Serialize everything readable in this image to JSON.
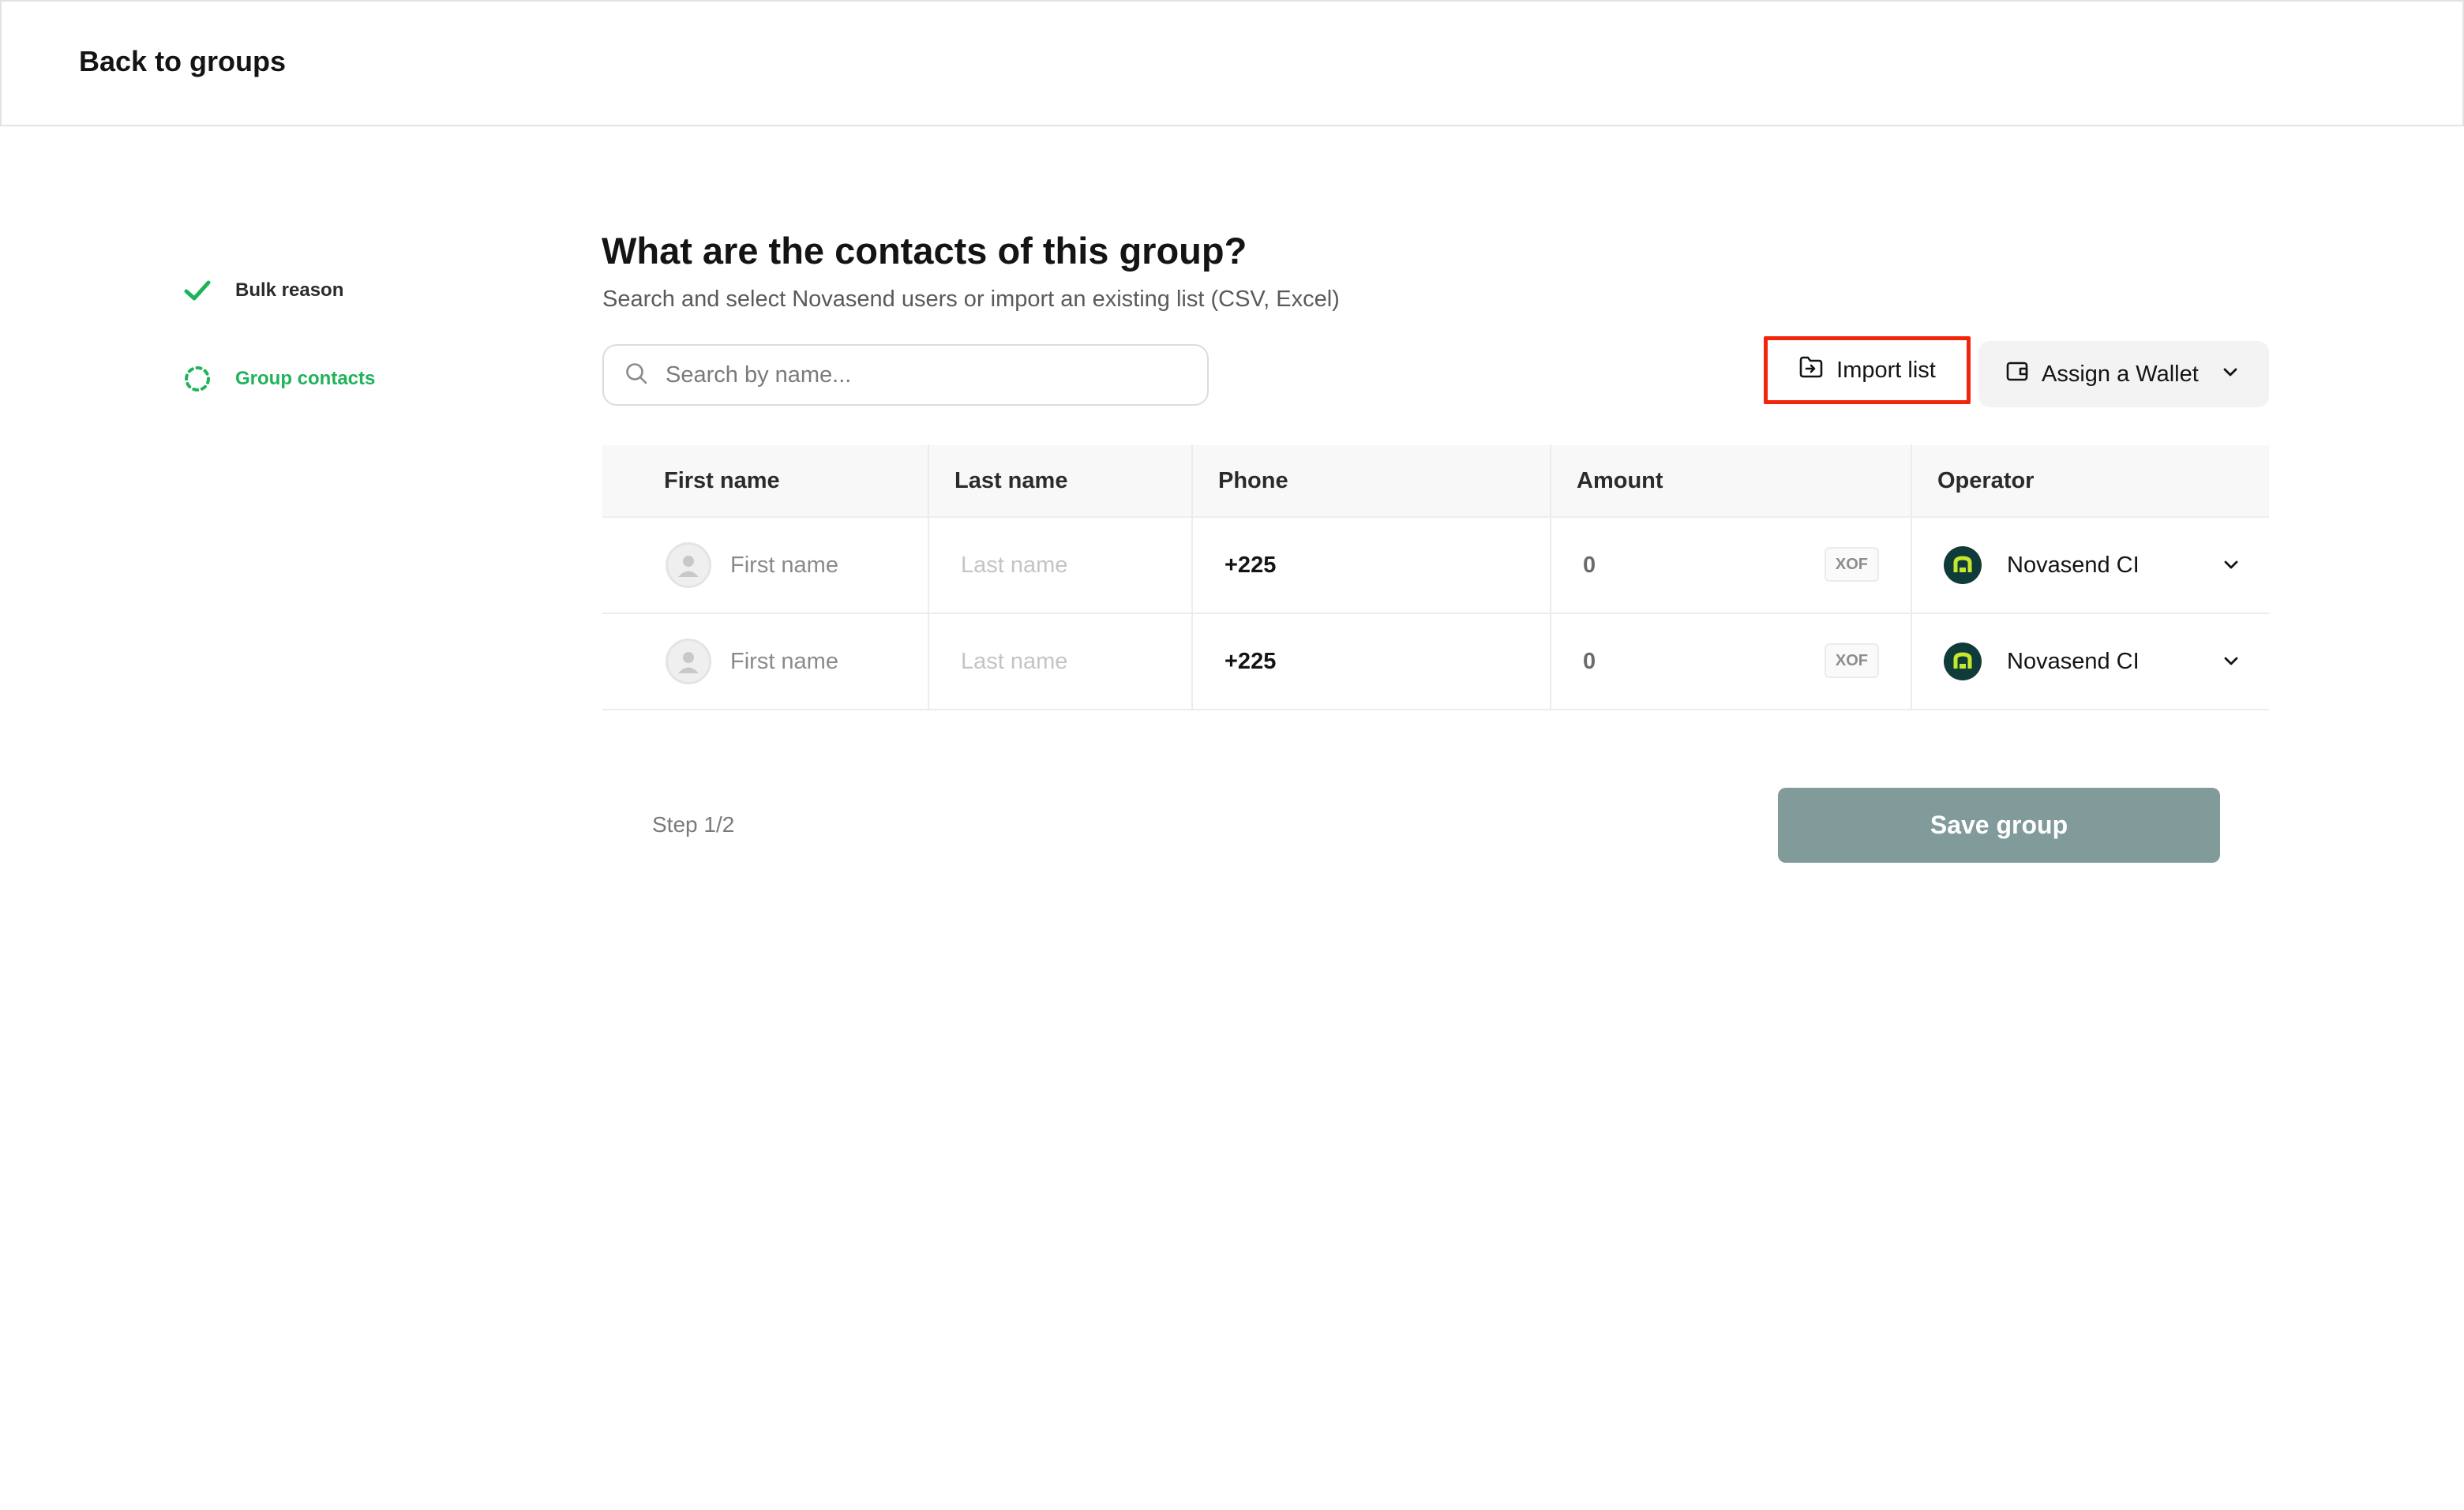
{
  "header": {
    "back_label": "Back to groups"
  },
  "stepper": {
    "steps": [
      {
        "label": "Bulk reason",
        "state": "done",
        "icon": "check-icon"
      },
      {
        "label": "Group contacts",
        "state": "active",
        "icon": "progress-ring-icon"
      }
    ]
  },
  "main": {
    "title": "What are the contacts of this group?",
    "subtitle": "Search and select Novasend users or import an existing list (CSV, Excel)",
    "search": {
      "placeholder": "Search by name...",
      "value": ""
    },
    "import_label": "Import list",
    "wallet_label": "Assign a Wallet"
  },
  "table": {
    "columns": [
      "First name",
      "Last name",
      "Phone",
      "Amount",
      "Operator"
    ],
    "rows": [
      {
        "first_name_placeholder": "First name",
        "last_name_placeholder": "Last name",
        "phone": "+225",
        "amount": "0",
        "currency": "XOF",
        "operator": "Novasend CI"
      },
      {
        "first_name_placeholder": "First name",
        "last_name_placeholder": "Last name",
        "phone": "+225",
        "amount": "0",
        "currency": "XOF",
        "operator": "Novasend CI"
      }
    ]
  },
  "footer": {
    "step_counter": "Step 1/2",
    "save_label": "Save group"
  },
  "colors": {
    "accent_green": "#1fb35a",
    "highlight_red": "#f0250a",
    "save_button": "#819b9a",
    "operator_logo_bg": "#0f3b3b",
    "operator_logo_fg": "#c6e82b"
  }
}
